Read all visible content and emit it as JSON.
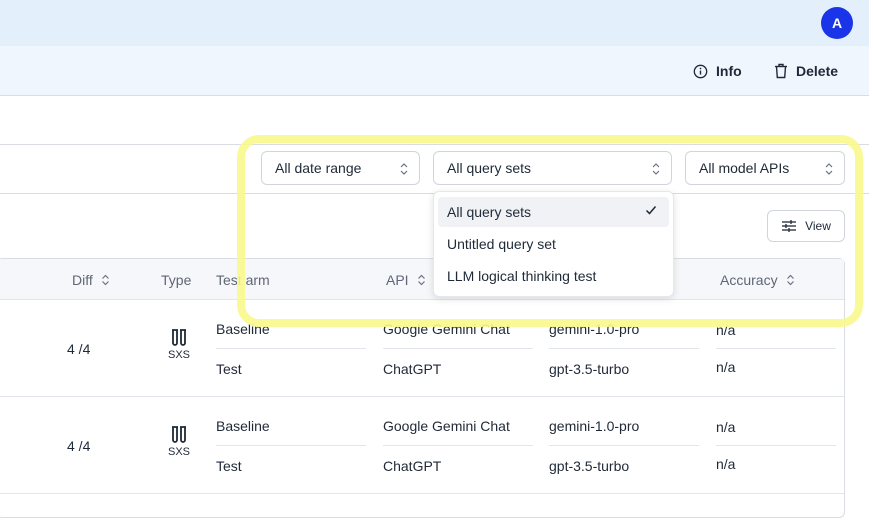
{
  "header": {
    "avatar_initial": "A"
  },
  "actions": {
    "info_label": "Info",
    "delete_label": "Delete"
  },
  "filters": {
    "date_range": "All date range",
    "query_sets": "All query sets",
    "model_apis": "All model APIs"
  },
  "dropdown": {
    "options": [
      "All query sets",
      "Untitled query set",
      "LLM logical thinking test"
    ],
    "selected": "All query sets"
  },
  "toolbar": {
    "view_label": "View"
  },
  "table": {
    "columns": {
      "diff": "Diff",
      "type": "Type",
      "test_arm": "Test arm",
      "api": "API",
      "accuracy": "Accuracy"
    },
    "rows": [
      {
        "diff": "4 /4",
        "type_label": "SXS",
        "arms": [
          {
            "arm": "Baseline",
            "api": "Google Gemini Chat",
            "model": "gemini-1.0-pro",
            "accuracy": "n/a"
          },
          {
            "arm": "Test",
            "api": "ChatGPT",
            "model": "gpt-3.5-turbo",
            "accuracy": "n/a"
          }
        ]
      },
      {
        "diff": "4 /4",
        "type_label": "SXS",
        "arms": [
          {
            "arm": "Baseline",
            "api": "Google Gemini Chat",
            "model": "gemini-1.0-pro",
            "accuracy": "n/a"
          },
          {
            "arm": "Test",
            "api": "ChatGPT",
            "model": "gpt-3.5-turbo",
            "accuracy": "n/a"
          }
        ]
      }
    ]
  },
  "colors": {
    "avatar": "#1a34e8",
    "highlight": "#faf88c",
    "topbar": "#e3effb"
  }
}
